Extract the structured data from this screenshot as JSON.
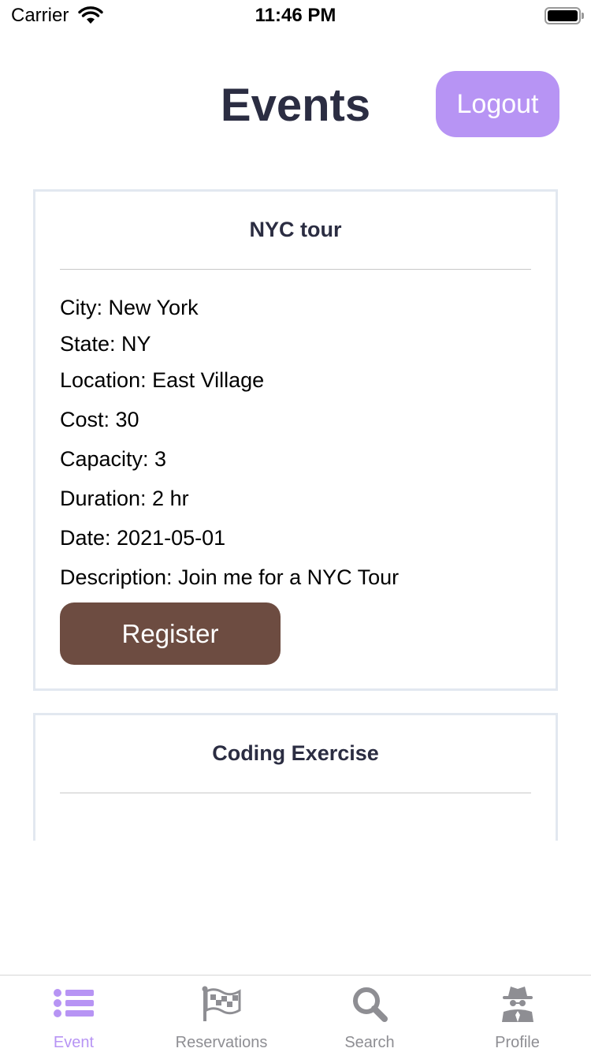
{
  "status_bar": {
    "carrier": "Carrier",
    "time": "11:46 PM"
  },
  "header": {
    "title": "Events",
    "logout_label": "Logout"
  },
  "events": [
    {
      "title": "NYC tour",
      "details": {
        "city": "City: New York",
        "state": "State: NY",
        "location": "Location: East Village",
        "cost": "Cost: 30",
        "capacity": "Capacity: 3",
        "duration": "Duration: 2 hr",
        "date": "Date: 2021-05-01",
        "description": "Description: Join me for a NYC Tour"
      },
      "register_label": "Register"
    },
    {
      "title": "Coding Exercise"
    }
  ],
  "tab_bar": {
    "tabs": [
      {
        "label": "Event",
        "icon": "list-icon",
        "active": true
      },
      {
        "label": "Reservations",
        "icon": "flag-icon",
        "active": false
      },
      {
        "label": "Search",
        "icon": "search-icon",
        "active": false
      },
      {
        "label": "Profile",
        "icon": "spy-icon",
        "active": false
      }
    ]
  },
  "colors": {
    "accent": "#b794f4",
    "register_button": "#6d4c41",
    "title_text": "#2b2d42",
    "tab_inactive": "#8e8e93"
  }
}
